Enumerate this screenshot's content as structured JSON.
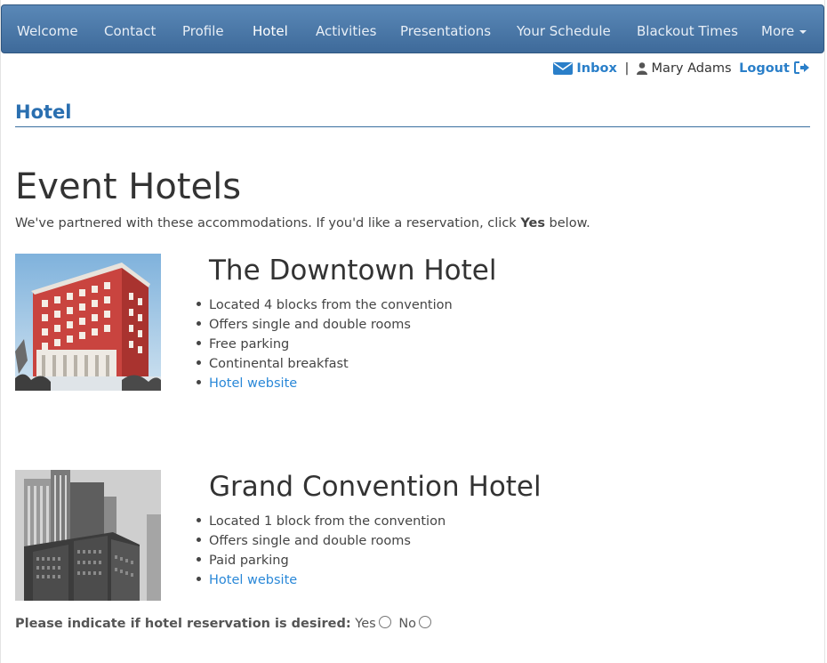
{
  "nav": {
    "items": [
      {
        "label": "Welcome"
      },
      {
        "label": "Contact"
      },
      {
        "label": "Profile"
      },
      {
        "label": "Hotel",
        "active": true
      },
      {
        "label": "Activities"
      },
      {
        "label": "Presentations"
      },
      {
        "label": "Your Schedule"
      },
      {
        "label": "Blackout Times"
      },
      {
        "label": "More"
      }
    ]
  },
  "userbar": {
    "inbox_label": "Inbox",
    "separator": "|",
    "user_name": "Mary Adams",
    "logout_label": "Logout",
    "icons": [
      "envelope-icon",
      "user-icon",
      "logout-icon"
    ]
  },
  "section": {
    "title": "Hotel"
  },
  "main": {
    "heading": "Event Hotels",
    "intro_prefix": "We've partnered with these accommodations. If you'd like a reservation, click ",
    "intro_bold": "Yes",
    "intro_suffix": " below."
  },
  "hotels": [
    {
      "name": "The Downtown Hotel",
      "features": [
        "Located 4 blocks from the convention",
        "Offers single and double rooms",
        "Free parking",
        "Continental breakfast"
      ],
      "website_label": "Hotel website"
    },
    {
      "name": "Grand Convention Hotel",
      "features": [
        "Located 1 block from the convention",
        "Offers single and double rooms",
        "Paid parking"
      ],
      "website_label": "Hotel website"
    }
  ],
  "reservation": {
    "question": "Please indicate if hotel reservation is desired:",
    "yes_label": "Yes",
    "no_label": "No"
  },
  "colors": {
    "nav_bg": "#4a78a8",
    "accent": "#2a6fb0",
    "link": "#2a88d8"
  }
}
